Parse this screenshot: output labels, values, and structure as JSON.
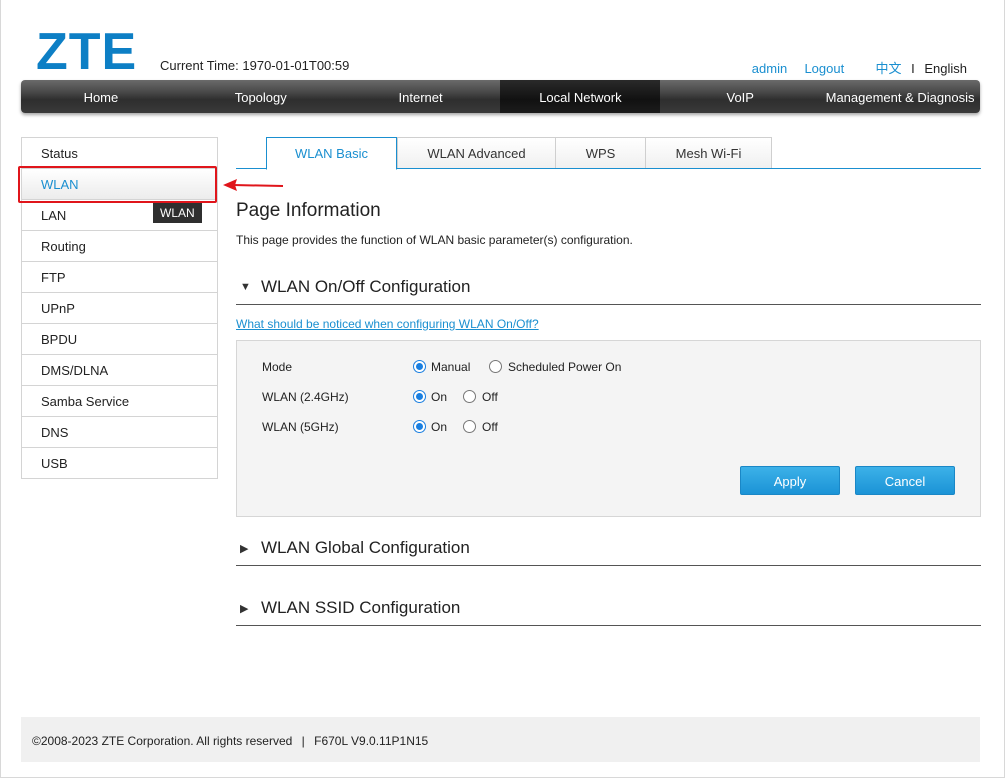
{
  "header": {
    "logo": "ZTE",
    "current_time_label": "Current Time:",
    "current_time_value": "1970-01-01T00:59",
    "user": "admin",
    "logout": "Logout",
    "lang_cn": "中文",
    "lang_sep": "I",
    "lang_en": "English"
  },
  "nav": {
    "items": [
      "Home",
      "Topology",
      "Internet",
      "Local Network",
      "VoIP",
      "Management & Diagnosis"
    ],
    "active": "Local Network"
  },
  "sidebar": {
    "items": [
      "Status",
      "WLAN",
      "LAN",
      "Routing",
      "FTP",
      "UPnP",
      "BPDU",
      "DMS/DLNA",
      "Samba Service",
      "DNS",
      "USB"
    ],
    "active": "WLAN",
    "tooltip": "WLAN"
  },
  "tabs": {
    "items": [
      "WLAN Basic",
      "WLAN Advanced",
      "WPS",
      "Mesh Wi-Fi"
    ],
    "active": "WLAN Basic"
  },
  "page": {
    "title": "Page Information",
    "description": "This page provides the function of WLAN basic parameter(s) configuration."
  },
  "sections": {
    "onoff": {
      "title": "WLAN On/Off Configuration",
      "expanded": true,
      "help_link": "What should be noticed when configuring WLAN On/Off?"
    },
    "global": {
      "title": "WLAN Global Configuration",
      "expanded": false
    },
    "ssid": {
      "title": "WLAN SSID Configuration",
      "expanded": false
    }
  },
  "form": {
    "mode": {
      "label": "Mode",
      "options": [
        "Manual",
        "Scheduled Power On"
      ],
      "selected": "Manual"
    },
    "wlan24": {
      "label": "WLAN (2.4GHz)",
      "options": [
        "On",
        "Off"
      ],
      "selected": "On"
    },
    "wlan5": {
      "label": "WLAN (5GHz)",
      "options": [
        "On",
        "Off"
      ],
      "selected": "On"
    },
    "apply": "Apply",
    "cancel": "Cancel"
  },
  "footer": {
    "copyright": "©2008-2023 ZTE Corporation. All rights reserved",
    "separator": "|",
    "version": "F670L V9.0.11P1N15"
  },
  "colors": {
    "brand": "#0d7fc5",
    "link": "#1a8fd0",
    "highlight": "#e0151b",
    "button": "#1b93d6"
  }
}
